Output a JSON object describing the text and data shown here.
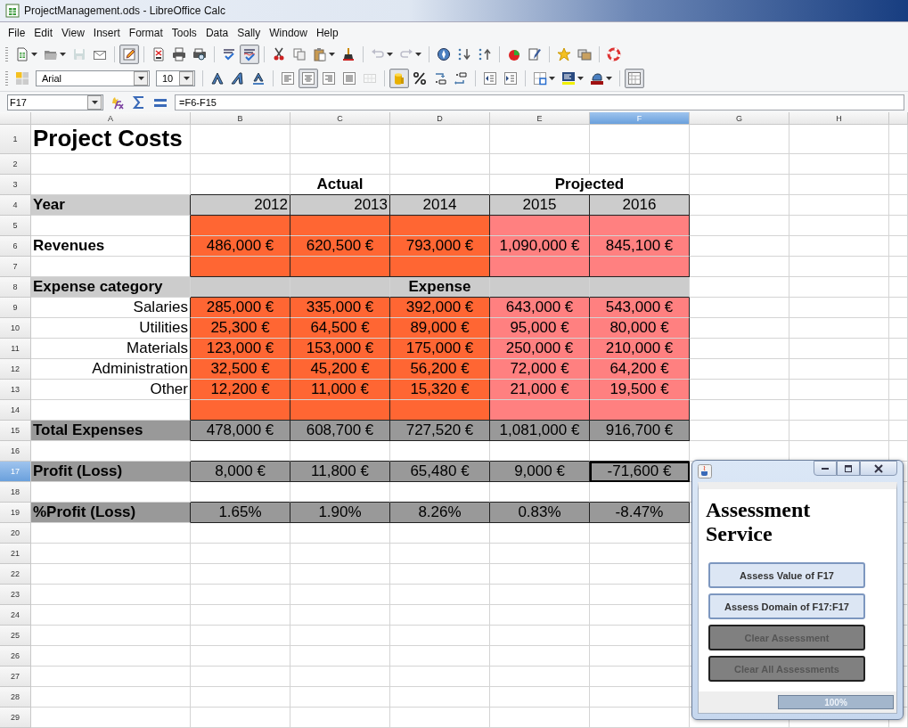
{
  "window": {
    "title": "ProjectManagement.ods - LibreOffice Calc"
  },
  "menu": [
    "File",
    "Edit",
    "View",
    "Insert",
    "Format",
    "Tools",
    "Data",
    "Sally",
    "Window",
    "Help"
  ],
  "toolbars": [
    {
      "groups": [
        [
          {
            "kind": "new",
            "pressed": false,
            "disabled": false,
            "dropdown": true
          },
          {
            "kind": "open",
            "pressed": false,
            "disabled": false,
            "dropdown": true
          },
          {
            "kind": "save",
            "pressed": false,
            "disabled": true,
            "dropdown": false
          },
          {
            "kind": "email",
            "pressed": false,
            "disabled": false,
            "dropdown": false
          }
        ],
        [
          {
            "kind": "edit",
            "pressed": true,
            "disabled": false,
            "dropdown": false
          }
        ],
        [
          {
            "kind": "pdf",
            "pressed": false,
            "disabled": false,
            "dropdown": false
          },
          {
            "kind": "print",
            "pressed": false,
            "disabled": false,
            "dropdown": false
          },
          {
            "kind": "preview",
            "pressed": false,
            "disabled": false,
            "dropdown": false
          }
        ],
        [
          {
            "kind": "spell",
            "pressed": false,
            "disabled": false,
            "dropdown": false
          },
          {
            "kind": "autospell",
            "pressed": true,
            "disabled": false,
            "dropdown": false
          }
        ],
        [
          {
            "kind": "cut",
            "pressed": false,
            "disabled": false,
            "dropdown": false
          },
          {
            "kind": "copy",
            "pressed": false,
            "disabled": false,
            "dropdown": false
          },
          {
            "kind": "paste",
            "pressed": false,
            "disabled": false,
            "dropdown": true
          },
          {
            "kind": "brush",
            "pressed": false,
            "disabled": false,
            "dropdown": false
          }
        ],
        [
          {
            "kind": "undo",
            "pressed": false,
            "disabled": true,
            "dropdown": true
          },
          {
            "kind": "redo",
            "pressed": false,
            "disabled": true,
            "dropdown": true
          }
        ],
        [
          {
            "kind": "navigator",
            "pressed": false,
            "disabled": false,
            "dropdown": false
          },
          {
            "kind": "sortasc",
            "pressed": false,
            "disabled": false,
            "dropdown": false
          },
          {
            "kind": "sortdesc",
            "pressed": false,
            "disabled": false,
            "dropdown": false
          }
        ],
        [
          {
            "kind": "chart",
            "pressed": false,
            "disabled": false,
            "dropdown": false
          },
          {
            "kind": "draw",
            "pressed": false,
            "disabled": false,
            "dropdown": false
          }
        ],
        [
          {
            "kind": "star",
            "pressed": false,
            "disabled": false,
            "dropdown": false
          },
          {
            "kind": "gallery",
            "pressed": false,
            "disabled": false,
            "dropdown": false
          }
        ],
        [
          {
            "kind": "help",
            "pressed": false,
            "disabled": false,
            "dropdown": false
          }
        ]
      ]
    },
    {
      "groups": [
        [
          {
            "kind": "styles",
            "pressed": false,
            "disabled": false,
            "dropdown": false
          },
          {
            "kind": "font-name",
            "value": "Arial"
          },
          {
            "kind": "font-size",
            "value": "10"
          }
        ],
        [
          {
            "kind": "bold",
            "pressed": false,
            "disabled": false,
            "dropdown": false
          },
          {
            "kind": "italic",
            "pressed": false,
            "disabled": false,
            "dropdown": false
          },
          {
            "kind": "underline",
            "pressed": false,
            "disabled": false,
            "dropdown": false
          }
        ],
        [
          {
            "kind": "left",
            "pressed": false,
            "disabled": false,
            "dropdown": false
          },
          {
            "kind": "center",
            "pressed": true,
            "disabled": false,
            "dropdown": false
          },
          {
            "kind": "right",
            "pressed": false,
            "disabled": false,
            "dropdown": false
          },
          {
            "kind": "justify",
            "pressed": false,
            "disabled": false,
            "dropdown": false
          },
          {
            "kind": "merge",
            "pressed": false,
            "disabled": true,
            "dropdown": false
          }
        ],
        [
          {
            "kind": "currency",
            "pressed": true,
            "disabled": false,
            "dropdown": false
          },
          {
            "kind": "percent",
            "pressed": false,
            "disabled": false,
            "dropdown": false
          },
          {
            "kind": "adddec",
            "pressed": false,
            "disabled": false,
            "dropdown": false
          },
          {
            "kind": "deldec",
            "pressed": false,
            "disabled": false,
            "dropdown": false
          }
        ],
        [
          {
            "kind": "outdent",
            "pressed": false,
            "disabled": false,
            "dropdown": false
          },
          {
            "kind": "indent",
            "pressed": false,
            "disabled": false,
            "dropdown": false
          }
        ],
        [
          {
            "kind": "borders",
            "pressed": false,
            "disabled": false,
            "dropdown": true
          },
          {
            "kind": "bgcolor",
            "pressed": false,
            "disabled": false,
            "dropdown": true
          },
          {
            "kind": "fontcolor",
            "pressed": false,
            "disabled": false,
            "dropdown": true
          }
        ],
        [
          {
            "kind": "grid",
            "pressed": true,
            "disabled": false,
            "dropdown": false
          }
        ]
      ]
    }
  ],
  "formula_bar": {
    "cell": "F17",
    "formula": "=F6-F15"
  },
  "sheet": {
    "columns": [
      {
        "label": "A",
        "selected": false
      },
      {
        "label": "B",
        "selected": false
      },
      {
        "label": "C",
        "selected": false
      },
      {
        "label": "D",
        "selected": false
      },
      {
        "label": "E",
        "selected": false
      },
      {
        "label": "F",
        "selected": true
      },
      {
        "label": "G",
        "selected": false
      },
      {
        "label": "H",
        "selected": false
      }
    ],
    "rows": [
      {
        "number": "1",
        "selected": false,
        "kind": "title",
        "cells": [
          {
            "text": "Project Costs"
          }
        ]
      },
      {
        "number": "2",
        "selected": false
      },
      {
        "number": "3",
        "selected": false,
        "kind": "group",
        "cells": [
          "",
          "",
          {
            "text": "Actual"
          },
          "",
          {
            "text": "Projected",
            "colspan": 2
          }
        ]
      },
      {
        "number": "4",
        "selected": false,
        "kind": "year",
        "cells": [
          {
            "text": "Year",
            "color": "#cccccc"
          },
          {
            "text": "2012",
            "color": "#cccccc"
          },
          {
            "text": "2013",
            "color": "#cccccc"
          },
          {
            "text": "2014",
            "color": "#cccccc"
          },
          {
            "text": "2015",
            "color": "#cccccc"
          },
          {
            "text": "2016",
            "color": "#cccccc"
          }
        ]
      },
      {
        "number": "5",
        "selected": false,
        "kind": "detail",
        "cells": [
          "",
          {
            "color": "#ff6633"
          },
          {
            "color": "#ff6633"
          },
          {
            "color": "#ff6633"
          },
          {
            "color": "#ff8080"
          },
          {
            "color": "#ff8080"
          }
        ]
      },
      {
        "number": "6",
        "selected": false,
        "kind": "label",
        "cells": [
          {
            "text": "Revenues"
          },
          {
            "text": "486,000 €",
            "color": "#ff6633"
          },
          {
            "text": "620,500 €",
            "color": "#ff6633"
          },
          {
            "text": "793,000 €",
            "color": "#ff6633"
          },
          {
            "text": "1,090,000 €",
            "color": "#ff8080"
          },
          {
            "text": "845,100 €",
            "color": "#ff8080"
          }
        ]
      },
      {
        "number": "7",
        "selected": false,
        "kind": "detail",
        "cells": [
          "",
          {
            "color": "#ff6633"
          },
          {
            "color": "#ff6633"
          },
          {
            "color": "#ff6633"
          },
          {
            "color": "#ff8080"
          },
          {
            "color": "#ff8080"
          }
        ]
      },
      {
        "number": "8",
        "selected": false,
        "kind": "heading",
        "cells": [
          {
            "text": "Expense category",
            "color": "#cccccc"
          },
          {
            "color": "#cccccc"
          },
          {
            "color": "#cccccc"
          },
          {
            "text": "Expense",
            "color": "#cccccc"
          },
          {
            "color": "#cccccc"
          },
          {
            "color": "#cccccc"
          }
        ]
      },
      {
        "number": "9",
        "selected": false,
        "kind": "detail",
        "cells": [
          {
            "text": "Salaries"
          },
          {
            "text": "285,000 €",
            "color": "#ff6633"
          },
          {
            "text": "335,000 €",
            "color": "#ff6633"
          },
          {
            "text": "392,000 €",
            "color": "#ff6633"
          },
          {
            "text": "643,000 €",
            "color": "#ff8080"
          },
          {
            "text": "543,000 €",
            "color": "#ff8080"
          }
        ]
      },
      {
        "number": "10",
        "selected": false,
        "kind": "detail",
        "cells": [
          {
            "text": "Utilities"
          },
          {
            "text": "25,300 €",
            "color": "#ff6633"
          },
          {
            "text": "64,500 €",
            "color": "#ff6633"
          },
          {
            "text": "89,000 €",
            "color": "#ff6633"
          },
          {
            "text": "95,000 €",
            "color": "#ff8080"
          },
          {
            "text": "80,000 €",
            "color": "#ff8080"
          }
        ]
      },
      {
        "number": "11",
        "selected": false,
        "kind": "detail",
        "cells": [
          {
            "text": "Materials"
          },
          {
            "text": "123,000 €",
            "color": "#ff6633"
          },
          {
            "text": "153,000 €",
            "color": "#ff6633"
          },
          {
            "text": "175,000 €",
            "color": "#ff6633"
          },
          {
            "text": "250,000 €",
            "color": "#ff8080"
          },
          {
            "text": "210,000 €",
            "color": "#ff8080"
          }
        ]
      },
      {
        "number": "12",
        "selected": false,
        "kind": "detail",
        "cells": [
          {
            "text": "Administration"
          },
          {
            "text": "32,500 €",
            "color": "#ff6633"
          },
          {
            "text": "45,200 €",
            "color": "#ff6633"
          },
          {
            "text": "56,200 €",
            "color": "#ff6633"
          },
          {
            "text": "72,000 €",
            "color": "#ff8080"
          },
          {
            "text": "64,200 €",
            "color": "#ff8080"
          }
        ]
      },
      {
        "number": "13",
        "selected": false,
        "kind": "detail",
        "cells": [
          {
            "text": "Other"
          },
          {
            "text": "12,200 €",
            "color": "#ff6633"
          },
          {
            "text": "11,000 €",
            "color": "#ff6633"
          },
          {
            "text": "15,320 €",
            "color": "#ff6633"
          },
          {
            "text": "21,000 €",
            "color": "#ff8080"
          },
          {
            "text": "19,500 €",
            "color": "#ff8080"
          }
        ]
      },
      {
        "number": "14",
        "selected": false,
        "kind": "detail",
        "cells": [
          "",
          {
            "color": "#ff6633"
          },
          {
            "color": "#ff6633"
          },
          {
            "color": "#ff6633"
          },
          {
            "color": "#ff8080"
          },
          {
            "color": "#ff8080"
          }
        ]
      },
      {
        "number": "15",
        "selected": false,
        "kind": "label",
        "cells": [
          {
            "text": "Total Expenses",
            "color": "#999999"
          },
          {
            "text": "478,000 €",
            "color": "#999999"
          },
          {
            "text": "608,700 €",
            "color": "#999999"
          },
          {
            "text": "727,520 €",
            "color": "#999999"
          },
          {
            "text": "1,081,000 €",
            "color": "#999999"
          },
          {
            "text": "916,700 €",
            "color": "#999999"
          }
        ]
      },
      {
        "number": "16",
        "selected": false
      },
      {
        "number": "17",
        "selected": true,
        "kind": "label",
        "cells": [
          {
            "text": "Profit (Loss)",
            "color": "#999999"
          },
          {
            "text": "8,000 €",
            "color": "#999999"
          },
          {
            "text": "11,800 €",
            "color": "#999999"
          },
          {
            "text": "65,480 €",
            "color": "#999999"
          },
          {
            "text": "9,000 €",
            "color": "#999999"
          },
          {
            "text": "-71,600 €",
            "color": "#999999"
          }
        ]
      },
      {
        "number": "18",
        "selected": false
      },
      {
        "number": "19",
        "selected": false,
        "kind": "label",
        "cells": [
          {
            "text": "%Profit (Loss)",
            "color": "#999999"
          },
          {
            "text": "1.65%",
            "color": "#999999"
          },
          {
            "text": "1.90%",
            "color": "#999999"
          },
          {
            "text": "8.26%",
            "color": "#999999"
          },
          {
            "text": "0.83%",
            "color": "#999999"
          },
          {
            "text": "-8.47%",
            "color": "#999999"
          }
        ]
      },
      {
        "number": "20",
        "selected": false
      },
      {
        "number": "21",
        "selected": false
      },
      {
        "number": "22",
        "selected": false
      },
      {
        "number": "23",
        "selected": false
      },
      {
        "number": "24",
        "selected": false
      },
      {
        "number": "25",
        "selected": false
      },
      {
        "number": "26",
        "selected": false
      },
      {
        "number": "27",
        "selected": false
      },
      {
        "number": "28",
        "selected": false
      },
      {
        "number": "29",
        "selected": false
      }
    ]
  },
  "dialog": {
    "title": "Assessment Service",
    "buttons": [
      {
        "label": "Assess Value of F17",
        "disabled": false
      },
      {
        "label": "Assess Domain of F17:F17",
        "disabled": false
      },
      {
        "label": "Clear Assessment",
        "disabled": true
      },
      {
        "label": "Clear All Assessments",
        "disabled": true
      }
    ],
    "progress": {
      "level": 1,
      "text": "100%"
    }
  }
}
